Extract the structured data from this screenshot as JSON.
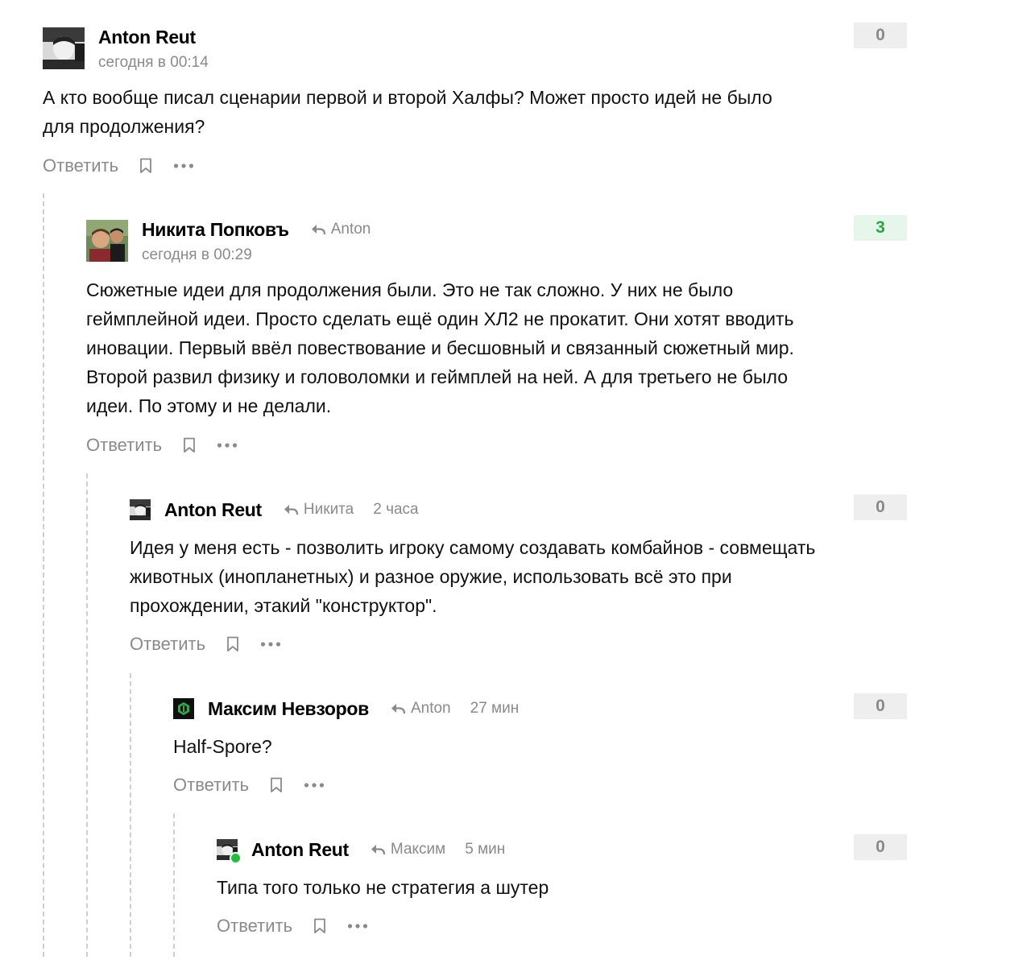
{
  "ui": {
    "reply_label": "Ответить"
  },
  "comments": [
    {
      "author": "Anton Reut",
      "time": "сегодня в 00:14",
      "text": "А кто вообще писал сценарии первой и второй Халфы? Может просто идей не было для продолжения?",
      "score": "0"
    },
    {
      "author": "Никита Попковъ",
      "reply_to": "Anton",
      "time": "сегодня в 00:29",
      "text": "Сюжетные идеи для продолжения были. Это не так сложно. У них не было геймплейной идеи. Просто сделать ещё один ХЛ2 не прокатит. Они хотят вводить иновации. Первый ввёл повествование и бесшовный и связанный сюжетный мир. Второй развил физику и головоломки и геймплей на ней. А для третьего не было идеи. По этому и не делали.",
      "score": "3"
    },
    {
      "author": "Anton Reut",
      "reply_to": "Никита",
      "time": "2 часа",
      "text": "Идея у меня есть - позволить игроку самому создавать комбайнов - совмещать животных (инопланетных) и разное оружие, использовать всё это при прохождении, этакий \"конструктор\".",
      "score": "0"
    },
    {
      "author": "Максим Невзоров",
      "reply_to": "Anton",
      "time": "27 мин",
      "text": "Half-Spore?",
      "score": "0"
    },
    {
      "author": "Anton Reut",
      "reply_to": "Максим",
      "time": "5 мин",
      "text": "Типа того только не стратегия а шутер",
      "score": "0"
    }
  ],
  "colors": {
    "muted": "#8a8a8a",
    "score_bg": "#eeeeee",
    "score_positive_bg": "#e6f6ea",
    "score_positive_text": "#2aa745",
    "online": "#1fbf3a"
  }
}
